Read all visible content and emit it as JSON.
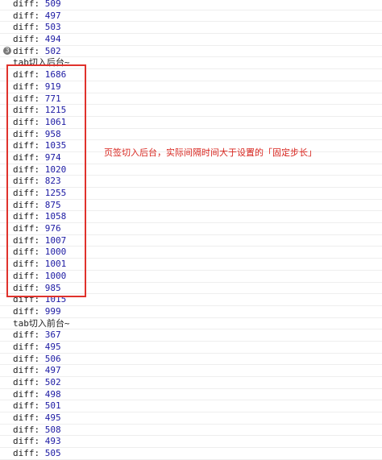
{
  "console": {
    "top_rows": [
      "509",
      "497",
      "503",
      "494"
    ],
    "grouped_row": {
      "badge": "3",
      "value": "502"
    },
    "background_label": "tab切入后台~",
    "background_rows": [
      "1686",
      "919",
      "771",
      "1215",
      "1061",
      "958",
      "1035",
      "974",
      "1020",
      "823",
      "1255",
      "875",
      "1058",
      "976",
      "1007",
      "1000",
      "1001",
      "1000",
      "985",
      "1015",
      "999"
    ],
    "foreground_label": "tab切入前台~",
    "foreground_rows": [
      "367",
      "495",
      "506",
      "497",
      "502",
      "498",
      "501",
      "495",
      "508",
      "493",
      "505"
    ],
    "key_label": "diff: "
  },
  "annotation": {
    "text": "页签切入后台，实际间隔时间大于设置的「固定步长」",
    "color": "#d8261f"
  },
  "colors": {
    "number": "#1c1aa3",
    "highlight_border": "#e0322c"
  }
}
